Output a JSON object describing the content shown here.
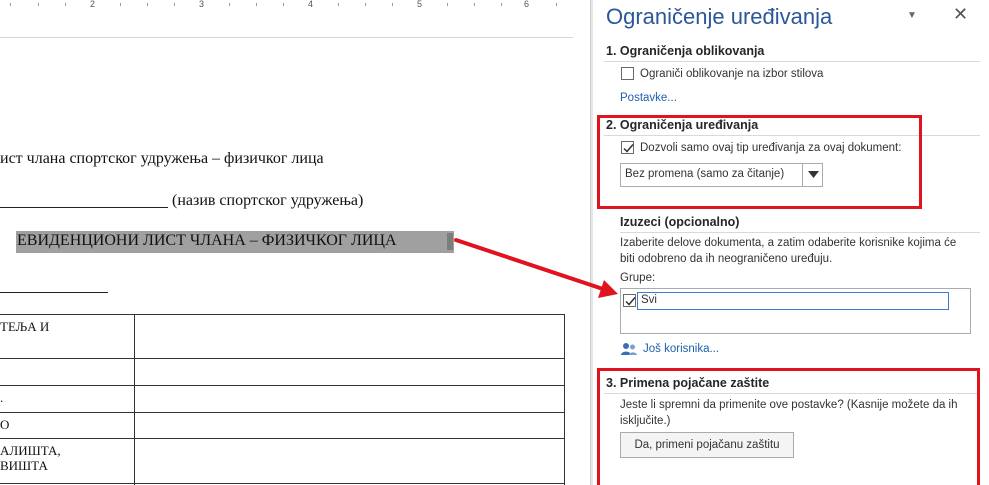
{
  "ruler": {
    "numbers": [
      "2",
      "3",
      "4",
      "5",
      "6"
    ]
  },
  "document": {
    "line1": "ист члана спортског удружења  – физичког лица",
    "line2_suffix": "(назив спортског удружења)",
    "highlighted_title": "ЕВИДЕНЦИОНИ ЛИСТ ЧЛАНА – ФИЗИЧКОГ ЛИЦА",
    "table_rows": [
      {
        "c1": "ТЕЉА И",
        "c2": ""
      },
      {
        "c1": "",
        "c2": ""
      },
      {
        "c1": ".",
        "c2": ""
      },
      {
        "c1": "О",
        "c2": ""
      },
      {
        "c1": "АЛИШТА,\nВИШТА",
        "c2": ""
      },
      {
        "c1": "",
        "c2": ""
      }
    ]
  },
  "pane": {
    "title": "Ograničenje uređivanja",
    "menu_icon": "dropdown-triangle-icon",
    "close_icon": "close-icon",
    "section1": {
      "heading": "1. Ograničenja oblikovanja",
      "checkbox_label": "Ograniči oblikovanje na izbor stilova",
      "checked": false,
      "settings_link": "Postavke..."
    },
    "section2": {
      "heading": "2. Ograničenja uređivanja",
      "checkbox_label": "Dozvoli samo ovaj tip uređivanja za ovaj dokument:",
      "checked": true,
      "dropdown_value": "Bez promena (samo za čitanje)"
    },
    "exceptions": {
      "heading": "Izuzeci (opcionalno)",
      "description_line1": "Izaberite delove dokumenta, a zatim odaberite korisnike kojima će",
      "description_line2": "biti odobreno da ih neograničeno uređuju.",
      "groups_label": "Grupe:",
      "group_item": "Svi",
      "group_checked": true,
      "more_users_link": "Još korisnika..."
    },
    "section3": {
      "heading": "3. Primena pojačane zaštite",
      "description_line1": "Jeste li spremni da primenite ove postavke? (Kasnije možete da ih",
      "description_line2": "isključite.)",
      "apply_button": "Da, primeni pojačanu zaštitu"
    }
  },
  "colors": {
    "accent": "#2b579a",
    "link": "#1e5fae",
    "annotation_red": "#e0141f",
    "highlight": "#a0a0a0"
  }
}
